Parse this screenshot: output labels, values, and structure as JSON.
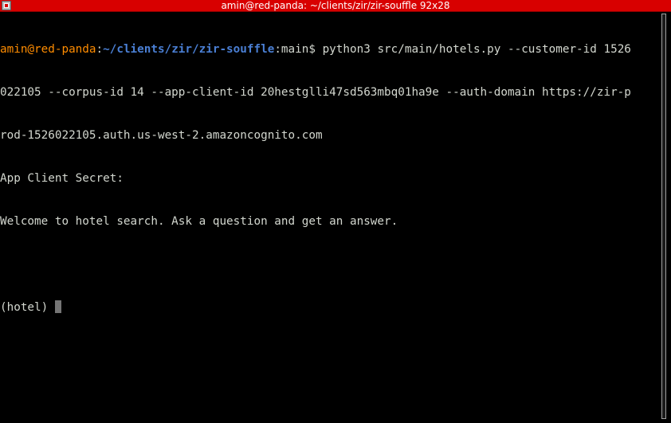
{
  "window": {
    "title": "amin@red-panda: ~/clients/zir/zir-souffle 92x28"
  },
  "terminal": {
    "prompt": {
      "user_host": "amin@red-panda",
      "colon": ":",
      "path": "~/clients/zir/zir-souffle",
      "git_branch": ":main",
      "dollar": "$ ",
      "command_line1": "python3 src/main/hotels.py --customer-id 1526"
    },
    "lines": [
      "022105 --corpus-id 14 --app-client-id 20hestglli47sd563mbq01ha9e --auth-domain https://zir-p",
      "rod-1526022105.auth.us-west-2.amazoncognito.com",
      "App Client Secret:",
      "Welcome to hotel search. Ask a question and get an answer.",
      "",
      "(hotel) "
    ]
  },
  "colors": {
    "titlebar": "#d80000",
    "user_host": "#ff8c00",
    "path": "#4a7fd4",
    "text": "#d3d7cf",
    "background": "#000000"
  }
}
